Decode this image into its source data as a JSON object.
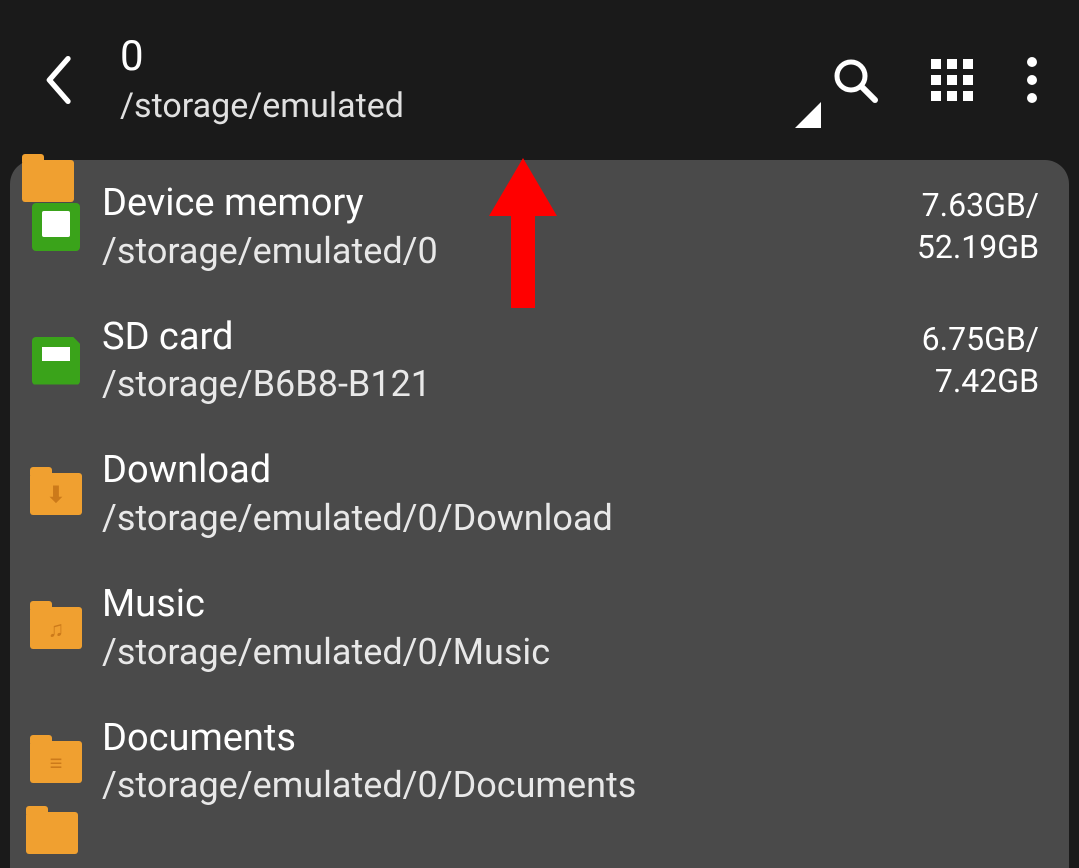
{
  "header": {
    "title": "0",
    "path": "/storage/emulated"
  },
  "storage": [
    {
      "icon": "device-memory",
      "title": "Device memory",
      "path": "/storage/emulated/0",
      "used": "7.63GB/",
      "total": "52.19GB"
    },
    {
      "icon": "sd-card",
      "title": "SD card",
      "path": "/storage/B6B8-B121",
      "used": "6.75GB/",
      "total": "7.42GB"
    },
    {
      "icon": "folder-download",
      "title": "Download",
      "path": "/storage/emulated/0/Download",
      "used": "",
      "total": ""
    },
    {
      "icon": "folder-music",
      "title": "Music",
      "path": "/storage/emulated/0/Music",
      "used": "",
      "total": ""
    },
    {
      "icon": "folder-documents",
      "title": "Documents",
      "path": "/storage/emulated/0/Documents",
      "used": "",
      "total": ""
    }
  ]
}
